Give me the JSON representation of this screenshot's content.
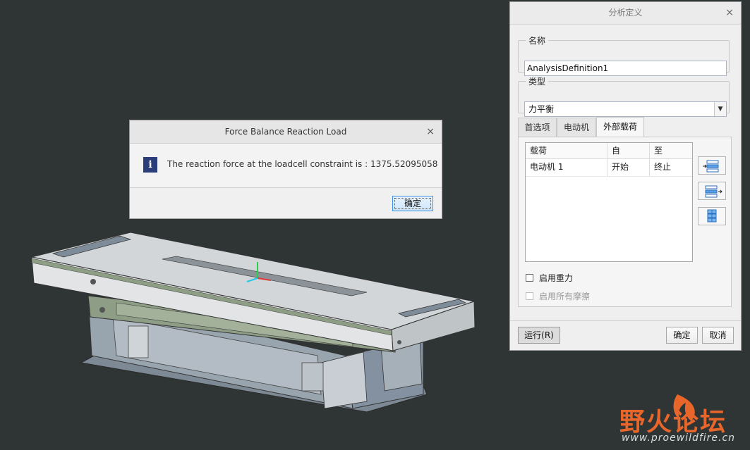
{
  "message_dialog": {
    "title": "Force Balance Reaction Load",
    "close_glyph": "×",
    "icon": "info-icon",
    "icon_glyph": "i",
    "text": "The reaction force at the loadcell constraint is : 1375.52095058",
    "ok_label": "确定"
  },
  "analysis_panel": {
    "title": "分析定义",
    "close_glyph": "×",
    "name_label": "名称",
    "name_value": "AnalysisDefinition1",
    "type_label": "类型",
    "type_value": "力平衡",
    "tabs": [
      {
        "label": "首选项"
      },
      {
        "label": "电动机"
      },
      {
        "label": "外部载荷"
      }
    ],
    "active_tab": "外部载荷",
    "table": {
      "headers": [
        "载荷",
        "自",
        "至"
      ],
      "rows": [
        {
          "load": "电动机 1",
          "from": "开始",
          "to": "终止"
        }
      ]
    },
    "side_buttons": [
      "insert-row-icon",
      "append-row-icon",
      "grid-icon"
    ],
    "enable_gravity_label": "启用重力",
    "enable_friction_label": "启用所有摩擦",
    "run_label": "运行(R)",
    "ok_label": "确定",
    "cancel_label": "取消"
  },
  "watermark": {
    "title": "野火论坛",
    "url": "www.proewildfire.cn"
  },
  "colors": {
    "background": "#2f3435",
    "accent": "#3a8ee6",
    "info_icon": "#2c3e7a",
    "watermark": "#e8662a"
  }
}
